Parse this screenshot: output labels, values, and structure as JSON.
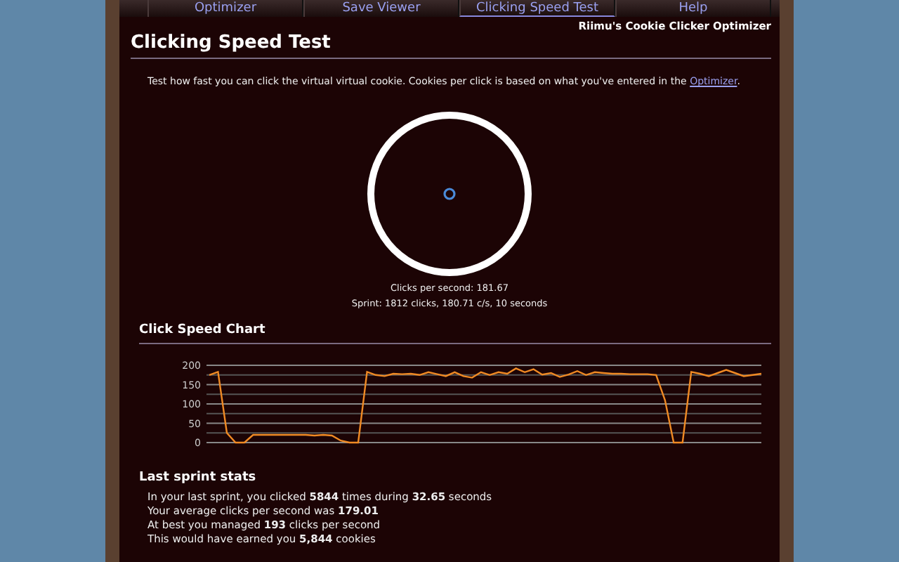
{
  "tabs": [
    {
      "label": "Optimizer",
      "selected": false
    },
    {
      "label": "Save Viewer",
      "selected": false
    },
    {
      "label": "Clicking Speed Test",
      "selected": true
    },
    {
      "label": "Help",
      "selected": false
    }
  ],
  "brand": "Riimu's Cookie Clicker Optimizer",
  "title": "Clicking Speed Test",
  "intro": {
    "text": "Test how fast you can click the virtual virtual cookie. Cookies per click is based on what you've entered in the",
    "link": "Optimizer",
    "end": "."
  },
  "readouts": [
    "Clicks per second: 181.67",
    "Sprint: 1812 clicks, 180.71 c/s, 10 seconds"
  ],
  "chart_section": {
    "title": "Click Speed Chart",
    "chart_data": {
      "type": "line",
      "grid": true,
      "ylim": [
        0,
        200
      ],
      "yticks": [
        0,
        50,
        100,
        150,
        200
      ],
      "series": [
        {
          "color": "#f08a24",
          "values": [
            175,
            183,
            25,
            0,
            0,
            20,
            20,
            20,
            20,
            20,
            20,
            20,
            18,
            20,
            18,
            5,
            0,
            0,
            183,
            175,
            172,
            178,
            177,
            178,
            175,
            182,
            177,
            172,
            182,
            172,
            168,
            182,
            175,
            182,
            178,
            192,
            182,
            190,
            176,
            180,
            170,
            176,
            185,
            175,
            182,
            180,
            178,
            178,
            177,
            177,
            177,
            175,
            110,
            0,
            0,
            183,
            178,
            172,
            180,
            188,
            180,
            172,
            175,
            178
          ]
        }
      ]
    }
  },
  "stats": {
    "title": "Last sprint stats",
    "lines": [
      "In your last sprint, you clicked **5844** times during **32.65** seconds",
      "Your average clicks per second was **179.01**",
      "At best you managed **193** clicks per second",
      "This would have earned you **5,844** cookies"
    ]
  }
}
